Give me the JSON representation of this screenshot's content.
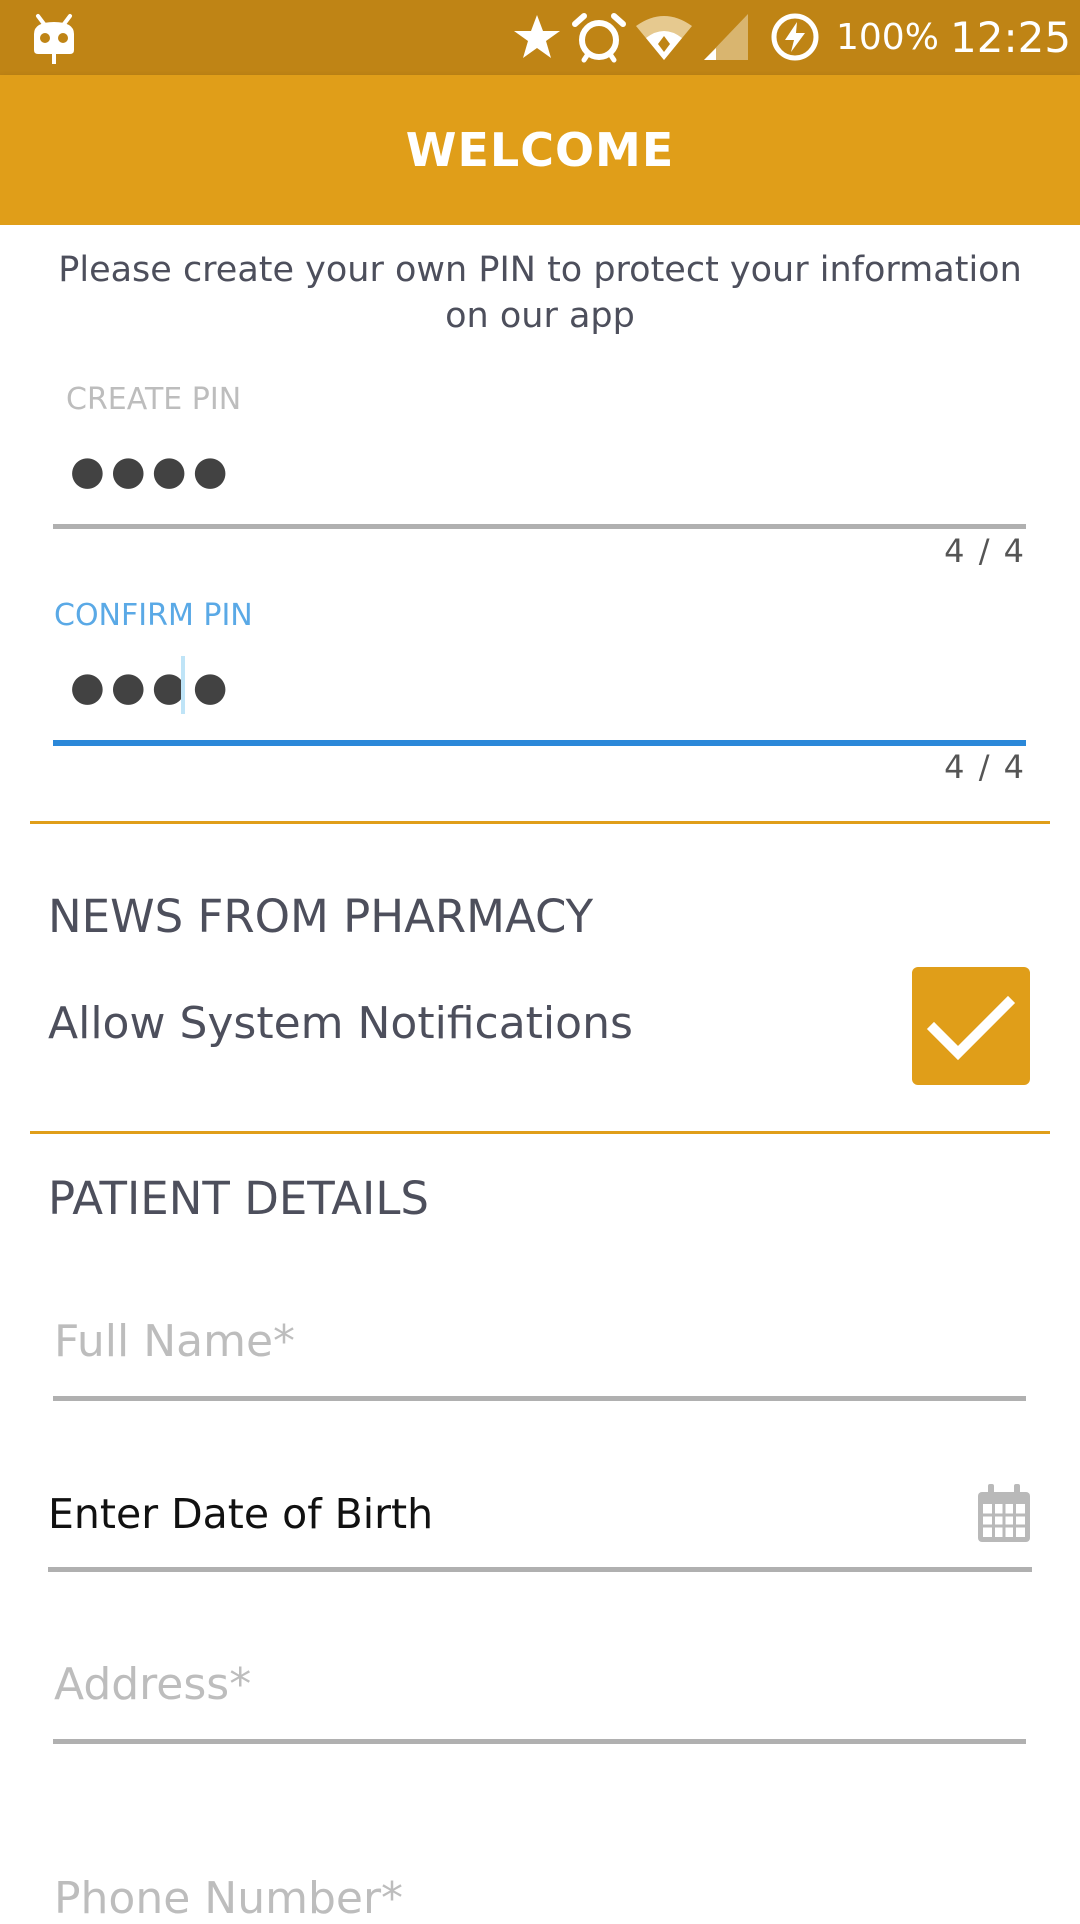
{
  "status_bar": {
    "battery_text": "100%",
    "time": "12:25",
    "icons": [
      "android-head-icon",
      "star-icon",
      "alarm-icon",
      "wifi-icon",
      "signal-icon",
      "battery-charging-icon"
    ]
  },
  "app_bar": {
    "title": "WELCOME",
    "color": "#e09e19"
  },
  "intro_text": "Please create your own PIN to protect your information on our app",
  "pin_fields": {
    "create": {
      "label": "CREATE PIN",
      "value": "●●●●",
      "counter": "4 / 4"
    },
    "confirm": {
      "label": "CONFIRM PIN",
      "value": "●●●●",
      "counter": "4 / 4"
    }
  },
  "news_section": {
    "title": "NEWS FROM PHARMACY",
    "notifications_label": "Allow System Notifications",
    "notifications_checked": true
  },
  "patient_section": {
    "title": "PATIENT DETAILS",
    "full_name_placeholder": "Full Name*",
    "dob_label": "Enter Date of Birth",
    "address_placeholder": "Address*",
    "phone_placeholder": "Phone Number*"
  },
  "colors": {
    "status_bar": "#bf8415",
    "accent": "#e09e19",
    "focus_blue": "#2b88d9",
    "label_blue": "#5aa9e6",
    "heading_text": "#4d4f5c"
  }
}
